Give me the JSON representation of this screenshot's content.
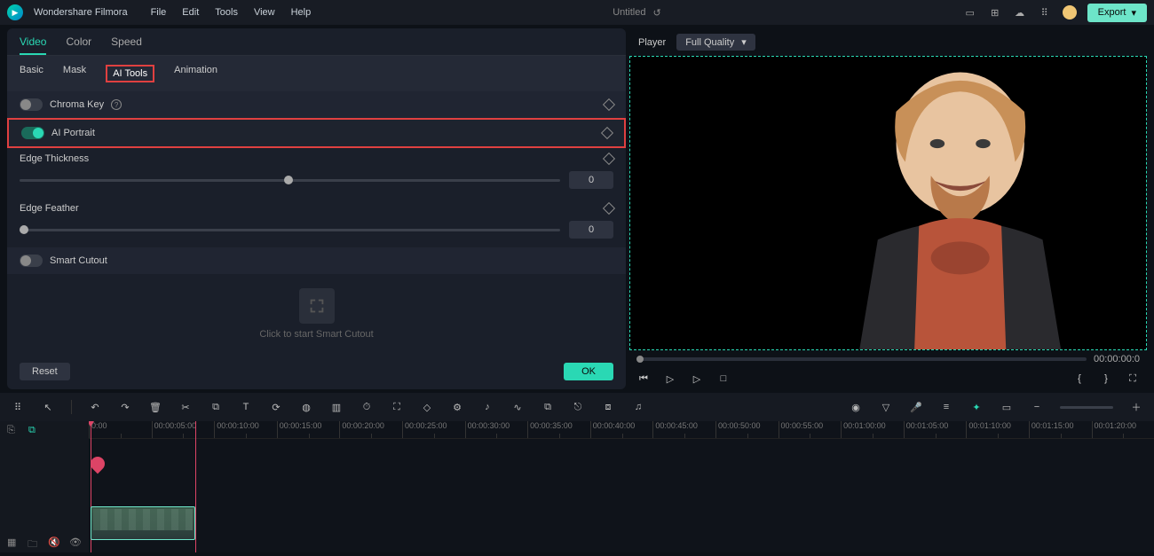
{
  "app": {
    "name": "Wondershare Filmora"
  },
  "menu": {
    "file": "File",
    "edit": "Edit",
    "tools": "Tools",
    "view": "View",
    "help": "Help"
  },
  "doc": {
    "title": "Untitled"
  },
  "export": {
    "label": "Export"
  },
  "panel": {
    "tabs1": {
      "video": "Video",
      "color": "Color",
      "speed": "Speed"
    },
    "tabs2": {
      "basic": "Basic",
      "mask": "Mask",
      "aitools": "AI Tools",
      "animation": "Animation"
    },
    "chroma": {
      "label": "Chroma Key"
    },
    "aiportrait": {
      "label": "AI Portrait"
    },
    "edgeThickness": {
      "label": "Edge Thickness",
      "value": "0"
    },
    "edgeFeather": {
      "label": "Edge Feather",
      "value": "0"
    },
    "smartCutout": {
      "label": "Smart Cutout",
      "hint": "Click to start Smart Cutout"
    },
    "reset": "Reset",
    "ok": "OK"
  },
  "player": {
    "label": "Player",
    "quality": "Full Quality",
    "timecode": "00:00:00:0"
  },
  "timeline": {
    "ticks": [
      "0:00",
      "00:00:05:00",
      "00:00:10:00",
      "00:00:15:00",
      "00:00:20:00",
      "00:00:25:00",
      "00:00:30:00",
      "00:00:35:00",
      "00:00:40:00",
      "00:00:45:00",
      "00:00:50:00",
      "00:00:55:00",
      "00:01:00:00",
      "00:01:05:00",
      "00:01:10:00",
      "00:01:15:00",
      "00:01:20:00"
    ]
  }
}
